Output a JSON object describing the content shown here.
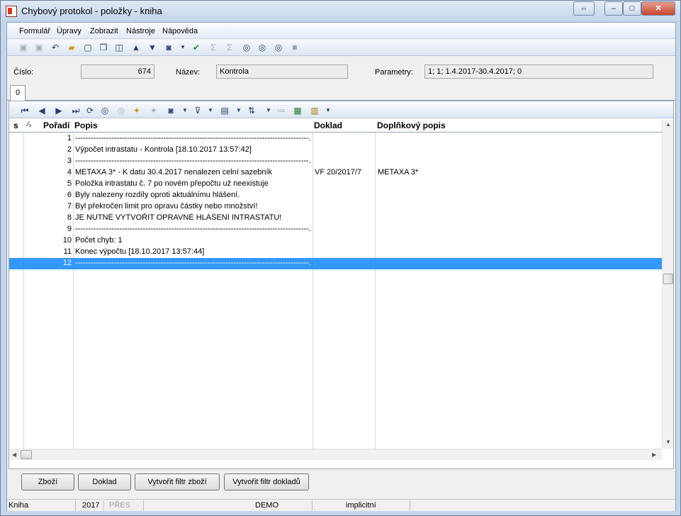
{
  "window": {
    "title": "Chybový protokol - položky - kniha",
    "restore_label": "⇔",
    "min_label": "–",
    "max_label": "□",
    "close_label": "✕"
  },
  "menu": [
    "Formulář",
    "Úpravy",
    "Zobrazit",
    "Nástroje",
    "Nápověda"
  ],
  "header": {
    "cislo_label": "Číslo:",
    "cislo_value": "674",
    "nazev_label": "Název:",
    "nazev_value": "Kontrola",
    "parametry_label": "Parametry:",
    "parametry_value": "1; 1; 1.4.2017-30.4.2017; 0"
  },
  "tabs": [
    "0"
  ],
  "columns": {
    "s": "s",
    "sort": "⁄₁",
    "poradi": "Pořadí",
    "popis": "Popis",
    "doklad": "Doklad",
    "doplnkovy": "Doplňkový popis"
  },
  "rows": [
    {
      "n": "1",
      "popis": "------------------------------------------------------------------------------------------...",
      "doklad": "",
      "dopl": ""
    },
    {
      "n": "2",
      "popis": "Výpočet intrastatu - Kontrola [18.10.2017 13:57:42]",
      "doklad": "",
      "dopl": ""
    },
    {
      "n": "3",
      "popis": "------------------------------------------------------------------------------------------...",
      "doklad": "",
      "dopl": ""
    },
    {
      "n": "4",
      "popis": "METAXA 3* - K datu 30.4.2017 nenalezen celní sazebník",
      "doklad": "VF 20/2017/7",
      "dopl": "METAXA 3*"
    },
    {
      "n": "5",
      "popis": "Položka intrastatu č. 7 po novém přepočtu už neexistuje",
      "doklad": "",
      "dopl": ""
    },
    {
      "n": "6",
      "popis": "Byly nalezeny rozdíly oproti aktuálnímu hlášení.",
      "doklad": "",
      "dopl": ""
    },
    {
      "n": "7",
      "popis": "Byl překročen limit pro opravu částky nebo množství!",
      "doklad": "",
      "dopl": ""
    },
    {
      "n": "8",
      "popis": "JE NUTNÉ VYTVOŘIT OPRAVNÉ HLÁŠENÍ INTRASTATU!",
      "doklad": "",
      "dopl": ""
    },
    {
      "n": "9",
      "popis": "------------------------------------------------------------------------------------------...",
      "doklad": "",
      "dopl": ""
    },
    {
      "n": "10",
      "popis": "Počet chyb: 1",
      "doklad": "",
      "dopl": ""
    },
    {
      "n": "11",
      "popis": "Konec výpočtu [18.10.2017 13:57:44]",
      "doklad": "",
      "dopl": ""
    },
    {
      "n": "12",
      "popis": "------------------------------------------------------------------------------------------...",
      "doklad": "",
      "dopl": "",
      "selected": true
    }
  ],
  "buttons": {
    "zbozi": "Zboží",
    "doklad": "Doklad",
    "filtr_zbozi": "Vytvořit filtr zboží",
    "filtr_dokladu": "Vytvořit filtr dokladů"
  },
  "status": {
    "kniha": "Kniha",
    "rok": "2017",
    "pres": "PŘES",
    "demo": "DEMO",
    "implicitni": "implicitní"
  },
  "colors": {
    "selection": "#3399ff",
    "titlebar": "#c5d6ea"
  }
}
